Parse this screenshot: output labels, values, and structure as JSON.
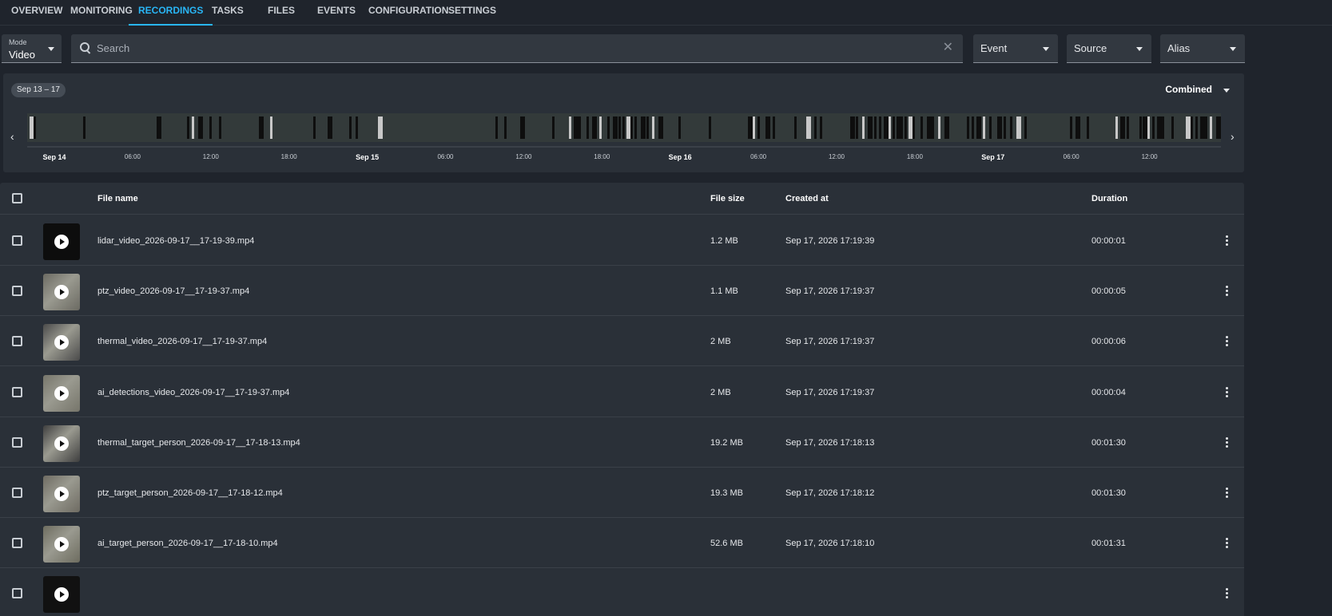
{
  "tabs": [
    {
      "label": "OVERVIEW",
      "active": false
    },
    {
      "label": "MONITORING",
      "active": false
    },
    {
      "label": "RECORDINGS",
      "active": true
    },
    {
      "label": "TASKS",
      "active": false
    },
    {
      "label": "FILES",
      "active": false
    },
    {
      "label": "EVENTS",
      "active": false
    },
    {
      "label": "CONFIGURATION",
      "active": false
    },
    {
      "label": "SETTINGS",
      "active": false
    }
  ],
  "filters": {
    "mode_caption": "Mode",
    "mode_value": "Video",
    "search_placeholder": "Search",
    "event_label": "Event",
    "source_label": "Source",
    "alias_label": "Alias"
  },
  "timeline": {
    "date_range": "Sep 13 – 17",
    "view_mode": "Combined",
    "ticks": [
      "Sep 14",
      "06:00",
      "12:00",
      "18:00",
      "Sep 15",
      "06:00",
      "12:00",
      "18:00",
      "Sep 16",
      "06:00",
      "12:00",
      "18:00",
      "Sep 17",
      "06:00",
      "12:00"
    ]
  },
  "table": {
    "columns": {
      "file_name": "File name",
      "file_size": "File size",
      "created_at": "Created at",
      "duration": "Duration"
    },
    "rows": [
      {
        "file_name": "lidar_video_2026-09-17__17-19-39.mp4",
        "file_size": "1.2 MB",
        "created_at": "Sep 17, 2026 17:19:39",
        "duration": "00:00:01",
        "thumb": "#0d0d0d"
      },
      {
        "file_name": "ptz_video_2026-09-17__17-19-37.mp4",
        "file_size": "1.1 MB",
        "created_at": "Sep 17, 2026 17:19:37",
        "duration": "00:00:05",
        "thumb": "#6b6a62"
      },
      {
        "file_name": "thermal_video_2026-09-17__17-19-37.mp4",
        "file_size": "2 MB",
        "created_at": "Sep 17, 2026 17:19:37",
        "duration": "00:00:06",
        "thumb": "#4a4a4a"
      },
      {
        "file_name": "ai_detections_video_2026-09-17__17-19-37.mp4",
        "file_size": "2 MB",
        "created_at": "Sep 17, 2026 17:19:37",
        "duration": "00:00:04",
        "thumb": "#76756a"
      },
      {
        "file_name": "thermal_target_person_2026-09-17__17-18-13.mp4",
        "file_size": "19.2 MB",
        "created_at": "Sep 17, 2026 17:18:13",
        "duration": "00:01:30",
        "thumb": "#3e3e3e"
      },
      {
        "file_name": "ptz_target_person_2026-09-17__17-18-12.mp4",
        "file_size": "19.3 MB",
        "created_at": "Sep 17, 2026 17:18:12",
        "duration": "00:01:30",
        "thumb": "#6e6b62"
      },
      {
        "file_name": "ai_target_person_2026-09-17__17-18-10.mp4",
        "file_size": "52.6 MB",
        "created_at": "Sep 17, 2026 17:18:10",
        "duration": "00:01:31",
        "thumb": "#6d6c5f"
      },
      {
        "file_name": "",
        "file_size": "",
        "created_at": "",
        "duration": "",
        "thumb": "#111111"
      }
    ]
  }
}
